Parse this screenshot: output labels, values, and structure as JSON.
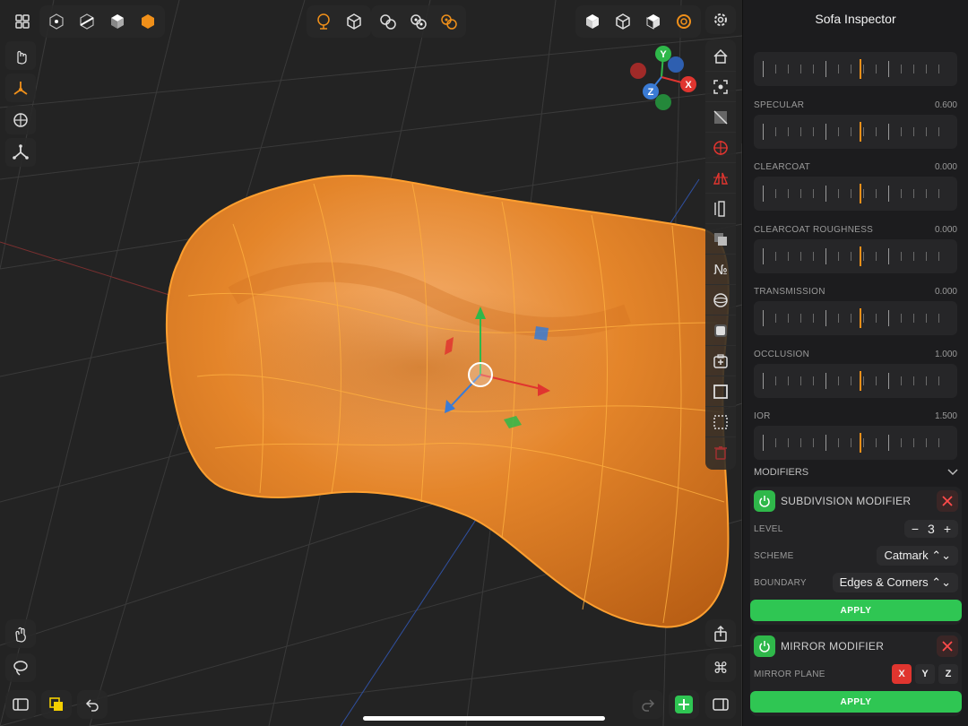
{
  "inspector": {
    "title": "Sofa Inspector",
    "properties": [
      {
        "label": "",
        "value": "",
        "marker": 0.52
      },
      {
        "label": "SPECULAR",
        "value": "0.600",
        "marker": 0.52
      },
      {
        "label": "CLEARCOAT",
        "value": "0.000",
        "marker": 0.52
      },
      {
        "label": "CLEARCOAT ROUGHNESS",
        "value": "0.000",
        "marker": 0.52
      },
      {
        "label": "TRANSMISSION",
        "value": "0.000",
        "marker": 0.52
      },
      {
        "label": "OCCLUSION",
        "value": "1.000",
        "marker": 0.52
      },
      {
        "label": "IOR",
        "value": "1.500",
        "marker": 0.52
      }
    ],
    "modifiers_header": "MODIFIERS",
    "subdivision": {
      "name": "SUBDIVISION MODIFIER",
      "level_label": "LEVEL",
      "level_value": "3",
      "minus": "−",
      "plus": "+",
      "scheme_label": "SCHEME",
      "scheme_value": "Catmark ⌃⌄",
      "boundary_label": "BOUNDARY",
      "boundary_value": "Edges & Corners ⌃⌄",
      "apply": "APPLY"
    },
    "mirror": {
      "name": "MIRROR MODIFIER",
      "plane_label": "MIRROR PLANE",
      "x": "X",
      "y": "Y",
      "z": "Z",
      "apply": "APPLY"
    }
  },
  "gizmo": {
    "x": "X",
    "y": "Y",
    "z": "Z"
  },
  "colors": {
    "accent": "#f0901a",
    "apply": "#2fc653",
    "object": "#e88a2a",
    "x_axis": "#e0352f",
    "y_axis": "#2fb84a",
    "z_axis": "#3a7bd5"
  },
  "icons": {
    "top_left": [
      "grid-icon",
      "vertex-mode-icon",
      "edge-mode-icon",
      "face-mode-icon",
      "object-mode-icon"
    ],
    "top_center": [
      "lasso-select-icon",
      "cube-outline-icon",
      "pivot-icon",
      "snap-icon",
      "proportional-icon"
    ],
    "top_right": [
      "solid-cube-icon",
      "wire-cube-icon",
      "shaded-cube-icon",
      "render-icon",
      "settings-gear-icon"
    ],
    "left": [
      "touch-icon",
      "move-gizmo-icon",
      "globe-icon",
      "transform-icon"
    ],
    "right": [
      "home-icon",
      "frame-icon",
      "wireframe-icon",
      "target-icon",
      "mirror-icon",
      "ruler-icon",
      "layers-icon",
      "numbers-icon",
      "sphere-icon",
      "material-icon",
      "add-icon",
      "square-icon",
      "selection-icon",
      "trash-icon"
    ],
    "bottom_left": [
      "hand-icon",
      "lasso-icon",
      "sidebar-icon",
      "color-icon",
      "undo-icon"
    ],
    "bottom_right": [
      "share-icon",
      "command-icon",
      "redo-icon",
      "add-object-icon",
      "panel-icon"
    ]
  }
}
